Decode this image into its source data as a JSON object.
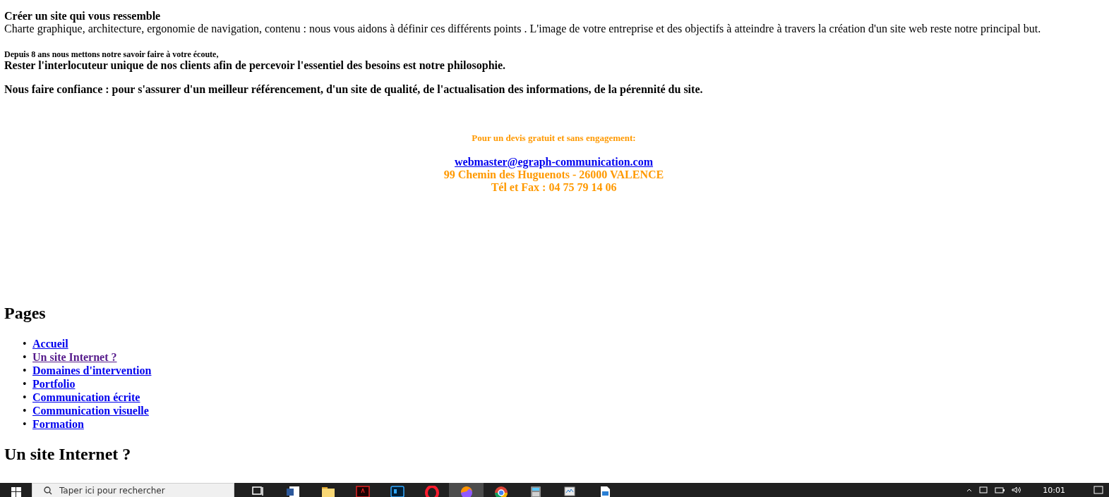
{
  "intro": {
    "title": "Créer un site qui vous ressemble",
    "text": "Charte graphique, architecture, ergonomie de navigation, contenu : nous vous aidons à définir ces différents points . L'image de votre entreprise et des objectifs à atteindre à travers la création d'un site web reste notre principal but."
  },
  "tagline": "Depuis 8 ans nous mettons notre savoir faire à votre écoute,",
  "philosophy": "Rester l'interlocuteur unique de nos clients afin de percevoir l'essentiel des besoins est notre philosophie.",
  "trust": "Nous faire confiance : pour s'assurer d'un meilleur référencement, d'un site de qualité, de l'actualisation des informations, de la pérennité du site.",
  "contact": {
    "lead": "Pour un devis gratuit et sans engagement:",
    "email": "webmaster@egraph-communication.com",
    "address": "99 Chemin des Huguenots - 26000 VALENCE",
    "phone": "Tél et Fax : 04 75 79 14 06"
  },
  "pages": {
    "heading": "Pages",
    "items": [
      {
        "marker": "•",
        "label": "Accueil",
        "visited": false
      },
      {
        "marker": "•",
        "label": "Un site Internet ?",
        "visited": true
      },
      {
        "marker": "•",
        "label": "Domaines d'intervention",
        "visited": false
      },
      {
        "marker": "•",
        "label": "Portfolio",
        "visited": false
      },
      {
        "marker": "•",
        "label": "Communication écrite",
        "visited": false
      },
      {
        "marker": "•",
        "label": "Communication visuelle",
        "visited": false
      },
      {
        "marker": "•",
        "label": "Formation",
        "visited": false
      }
    ]
  },
  "section_heading": "Un site Internet ?",
  "taskbar": {
    "search": {
      "placeholder": "Taper ici pour rechercher"
    },
    "apps": [
      {
        "kind": "taskview",
        "active": false
      },
      {
        "kind": "word",
        "active": false
      },
      {
        "kind": "folder",
        "active": false
      },
      {
        "kind": "pdf",
        "active": false
      },
      {
        "kind": "ps",
        "active": false
      },
      {
        "kind": "opera",
        "active": false
      },
      {
        "kind": "firefox",
        "active": true
      },
      {
        "kind": "chrome",
        "active": false
      },
      {
        "kind": "calculator",
        "active": false
      },
      {
        "kind": "monitor",
        "active": false
      },
      {
        "kind": "writer",
        "active": false
      }
    ],
    "clock": "10:01"
  }
}
